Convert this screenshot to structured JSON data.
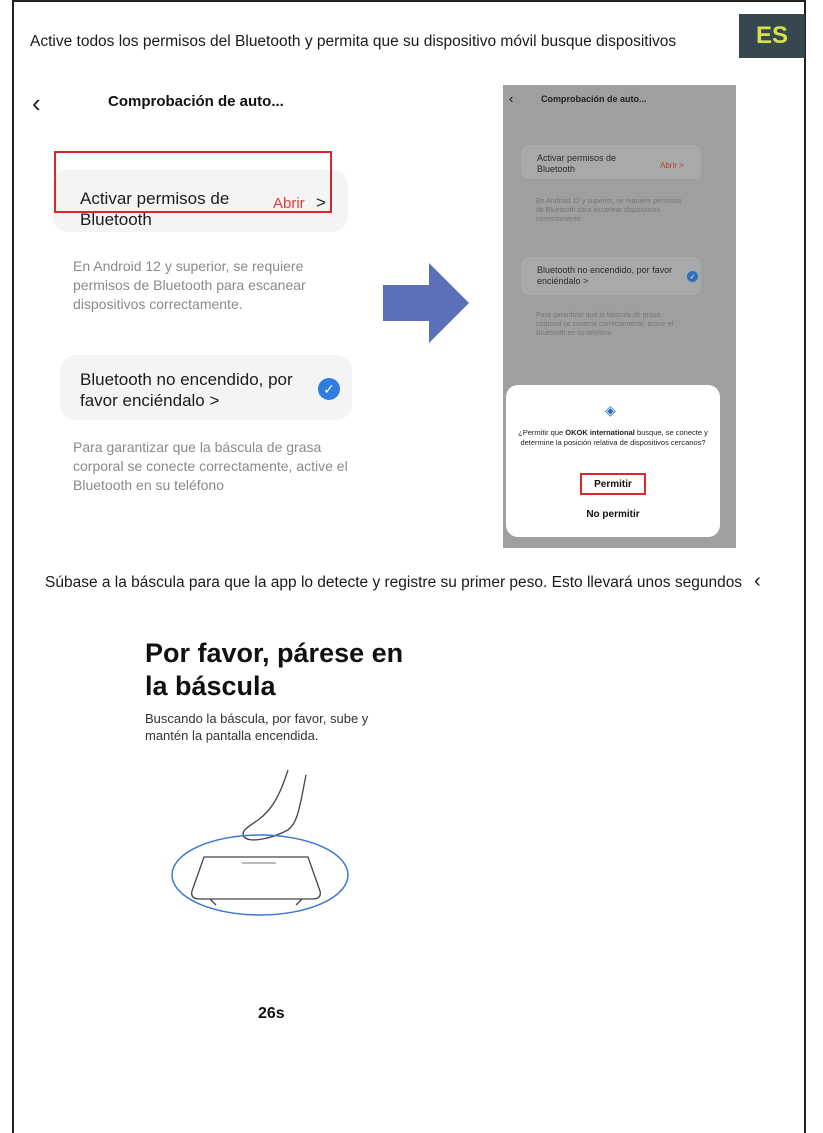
{
  "lang_badge": "ES",
  "step1": {
    "instruction": "Active todos los permisos del Bluetooth y permita que su dispositivo móvil busque dispositivos",
    "left_screen": {
      "back_icon": "chevron-left-icon",
      "title": "Comprobación de auto...",
      "card1_label": "Activar permisos de Bluetooth",
      "card1_action": "Abrir",
      "card1_note": "En Android 12 y superior, se requiere permisos de Bluetooth para escanear dispositivos correctamente.",
      "card2_label": "Bluetooth no encendido, por favor enciéndalo >",
      "card2_note": "Para garantizar que la báscula de grasa corporal se conecte correctamente, active el Bluetooth en su teléfono"
    },
    "right_screen": {
      "title": "Comprobación de auto...",
      "card1_label": "Activar permisos de Bluetooth",
      "card1_action": "Abrir",
      "card1_note": "En Android 12 y superior, se requiere permisos de Bluetooth para escanear dispositivos correctamente",
      "card2_label": "Bluetooth no encendido, por favor enciéndalo >",
      "card2_note": "Para garantizar que la báscula de grasa corporal se conecte correctamente, active el Bluetooth en su teléfono",
      "dialog_text_pre": "¿Permitir que ",
      "dialog_app": "OKOK international",
      "dialog_text_post": " busque, se conecte y determine la posición relativa de dispositivos cercanos?",
      "allow": "Permitir",
      "deny": "No permitir"
    }
  },
  "step2": {
    "instruction": "Súbase a la báscula para que la app lo detecte y registre su primer peso. Esto llevará unos segundos",
    "title": "Por favor, párese en la báscula",
    "subtitle": "Buscando la báscula, por favor, sube y mantén la pantalla encendida.",
    "timer": "26s"
  },
  "colors": {
    "badge_bg": "#37474f",
    "badge_text": "#d7e24a",
    "highlight": "#e0242b",
    "arrow": "#5b70b8",
    "check": "#2f7de0"
  }
}
